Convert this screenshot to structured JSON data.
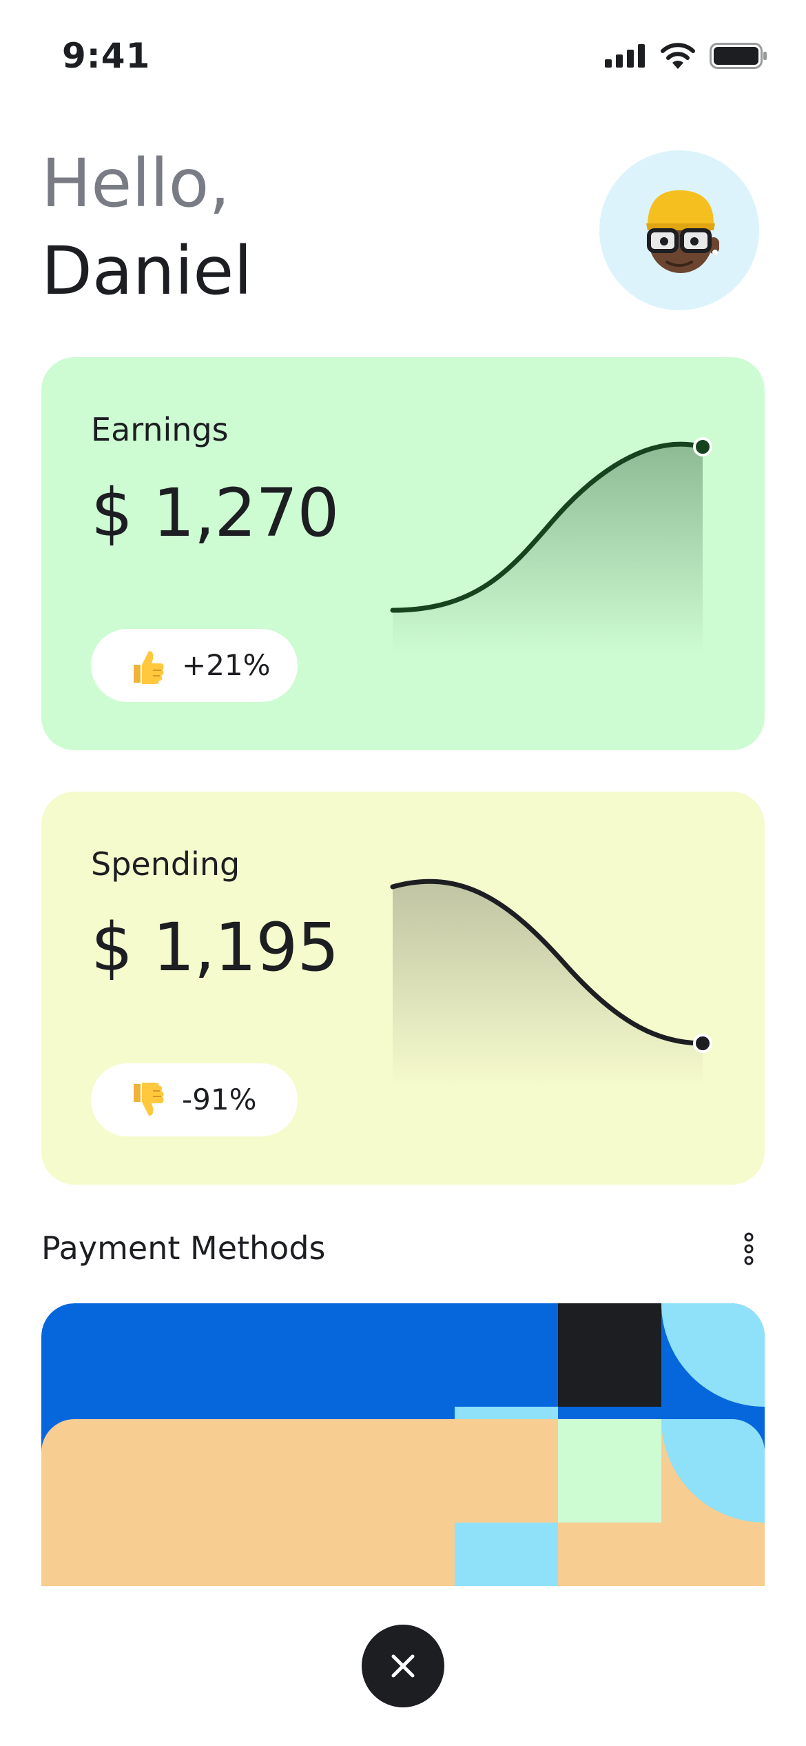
{
  "status_bar": {
    "time": "9:41",
    "icons": [
      "cellular-signal-icon",
      "wifi-icon",
      "battery-icon"
    ]
  },
  "greeting": {
    "hello": "Hello,",
    "name": "Daniel",
    "avatar_icon": "memoji-avatar"
  },
  "earnings": {
    "label": "Earnings",
    "value": "$ 1,270",
    "badge_icon": "thumbs-up-icon",
    "change": "+21%",
    "trend": "up",
    "colors": {
      "card": "#cdfbd2",
      "line": "#17431f"
    }
  },
  "spending": {
    "label": "Spending",
    "value": "$ 1,195",
    "badge_icon": "thumbs-down-icon",
    "change": "-91%",
    "trend": "down",
    "colors": {
      "card": "#f6fbcd",
      "line": "#1c1e22"
    }
  },
  "payment_methods": {
    "title": "Payment Methods",
    "menu_icon": "more-vertical-icon",
    "colors": [
      "#0667dd",
      "#f7cd92",
      "#1c1e22",
      "#8ee1f8",
      "#cdfbd2"
    ]
  },
  "close_button": {
    "icon": "close-icon"
  }
}
